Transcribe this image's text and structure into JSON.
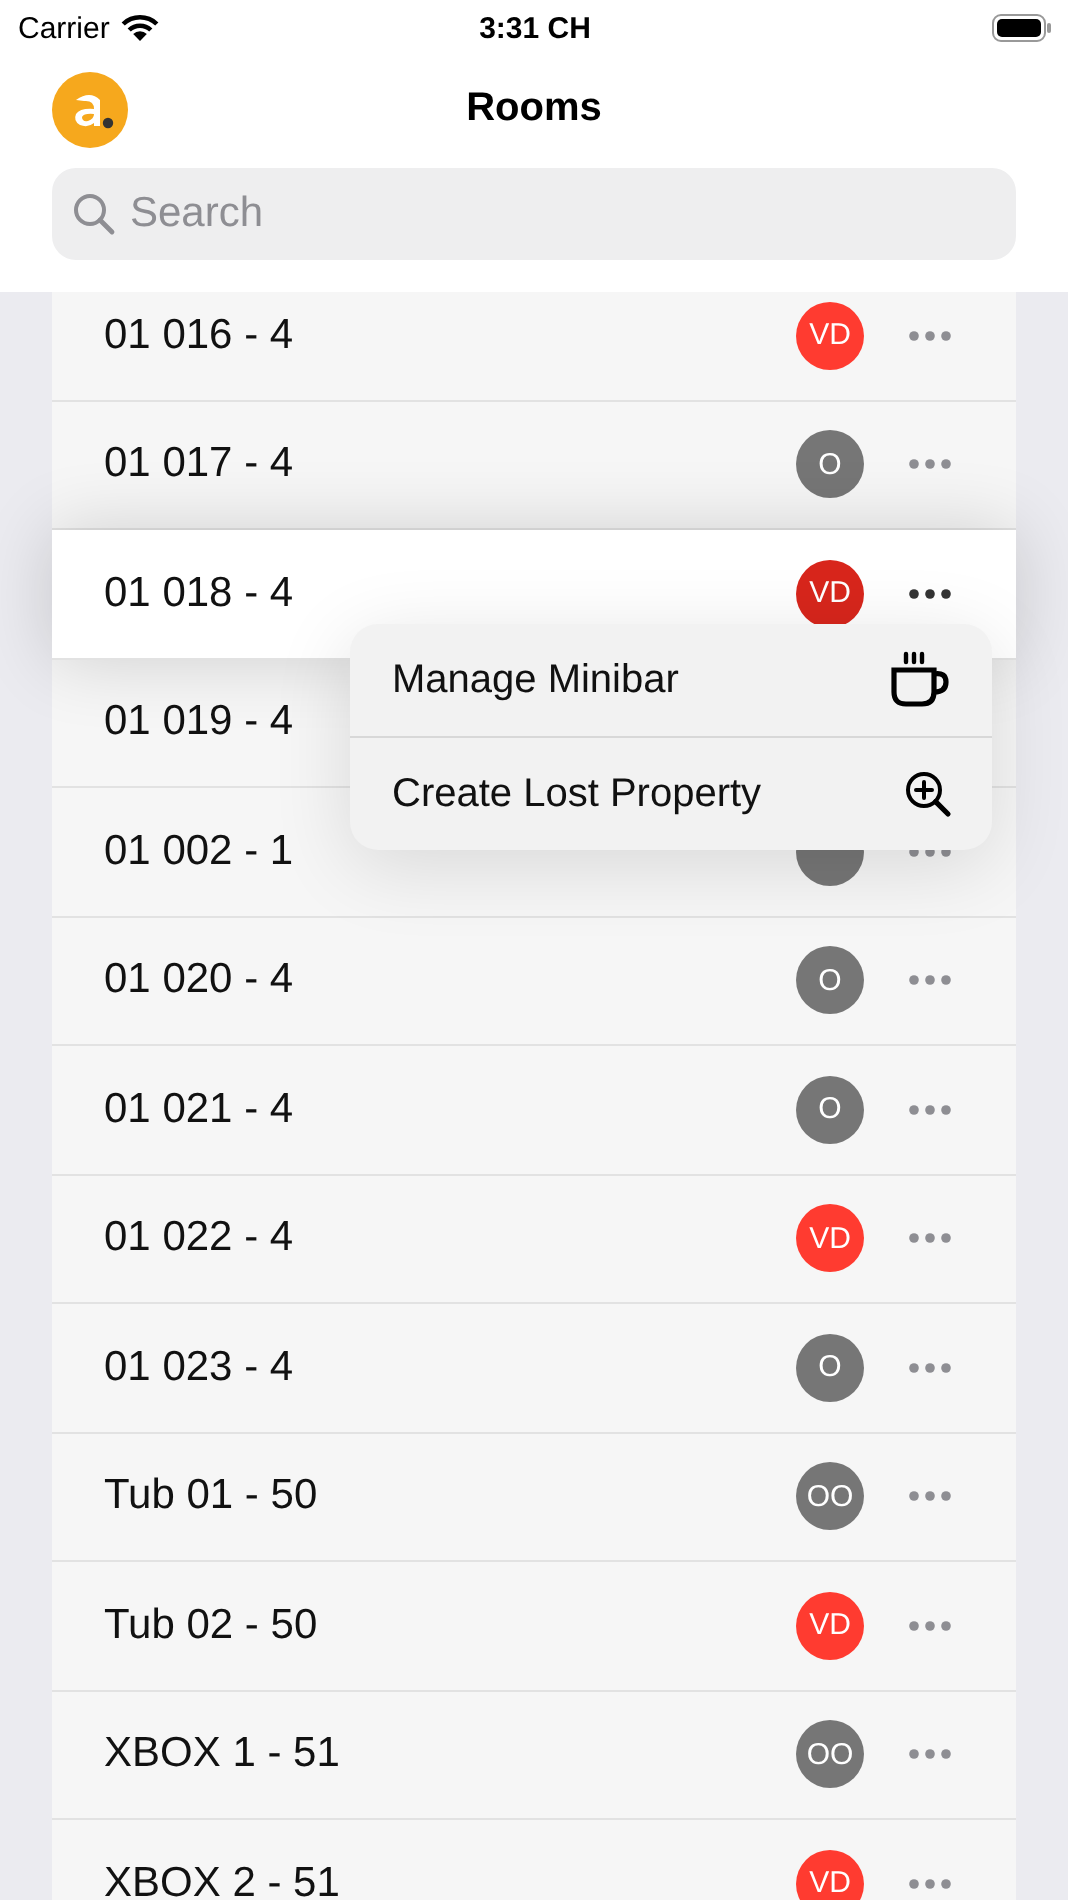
{
  "status_bar": {
    "carrier": "Carrier",
    "time": "3:31 CH"
  },
  "nav": {
    "title": "Rooms"
  },
  "search": {
    "placeholder": "Search"
  },
  "rooms": [
    {
      "name": "01 016 - 4",
      "status": "VD",
      "color": "#ff3b30",
      "selected": false
    },
    {
      "name": "01 017 - 4",
      "status": "O",
      "color": "#767676",
      "selected": false
    },
    {
      "name": "01 018 - 4",
      "status": "VD",
      "color": "#d8261c",
      "selected": true
    },
    {
      "name": "01 019 - 4",
      "selected": false
    },
    {
      "name": "01 002 - 1",
      "color": "#767676",
      "selected": false
    },
    {
      "name": "01 020 - 4",
      "status": "O",
      "color": "#767676",
      "selected": false
    },
    {
      "name": "01 021 - 4",
      "status": "O",
      "color": "#767676",
      "selected": false
    },
    {
      "name": "01 022 - 4",
      "status": "VD",
      "color": "#ff3b30",
      "selected": false
    },
    {
      "name": "01 023 - 4",
      "status": "O",
      "color": "#767676",
      "selected": false
    },
    {
      "name": "Tub 01 - 50",
      "status": "OO",
      "color": "#767676",
      "selected": false
    },
    {
      "name": "Tub 02 - 50",
      "status": "VD",
      "color": "#ff3b30",
      "selected": false
    },
    {
      "name": "XBOX 1 - 51",
      "status": "OO",
      "color": "#767676",
      "selected": false
    },
    {
      "name": "XBOX 2 - 51",
      "status": "VD",
      "color": "#ff3b30",
      "selected": false
    }
  ],
  "context_menu": [
    {
      "label": "Manage Minibar",
      "kind": "cup"
    },
    {
      "label": "Create Lost Property",
      "kind": "zoom"
    }
  ]
}
